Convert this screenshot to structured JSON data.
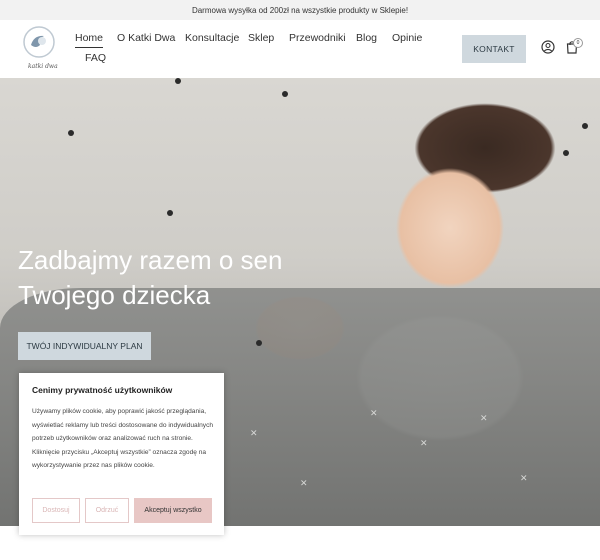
{
  "topbar": {
    "text": "Darmowa wysyłka od 200zł na wszystkie produkty w Sklepie!"
  },
  "logo": {
    "text": "katki dwa"
  },
  "nav": {
    "items": [
      {
        "label": "Home",
        "active": true
      },
      {
        "label": "O Katki Dwa"
      },
      {
        "label": "Konsultacje"
      },
      {
        "label": "Sklep"
      },
      {
        "label": "Przewodniki"
      },
      {
        "label": "Blog"
      },
      {
        "label": "Opinie"
      },
      {
        "label": "FAQ"
      }
    ]
  },
  "header": {
    "contact_label": "KONTAKT",
    "cart_count": "0",
    "user_icon": "user-icon",
    "cart_icon": "cart-icon"
  },
  "hero": {
    "title_line1": "Zadbajmy razem o sen",
    "title_line2": "Twojego dziecka",
    "cta_label": "TWÓJ INDYWIDUALNY PLAN"
  },
  "cookie": {
    "title": "Cenimy prywatność użytkowników",
    "text": "Używamy plików cookie, aby poprawić jakość przeglądania, wyświetlać reklamy lub treści dostosowane do indywidualnych potrzeb użytkowników oraz analizować ruch na stronie. Kliknięcie przycisku „Akceptuj wszystkie” oznacza zgodę na wykorzystywanie przez nas plików cookie.",
    "customize_label": "Dostosuj",
    "reject_label": "Odrzuć",
    "accept_label": "Akceptuj wszystko"
  },
  "colors": {
    "button_bg": "#cfd8de",
    "accept_bg": "#e8c7c5",
    "topbar_bg": "#f2f2f2"
  }
}
